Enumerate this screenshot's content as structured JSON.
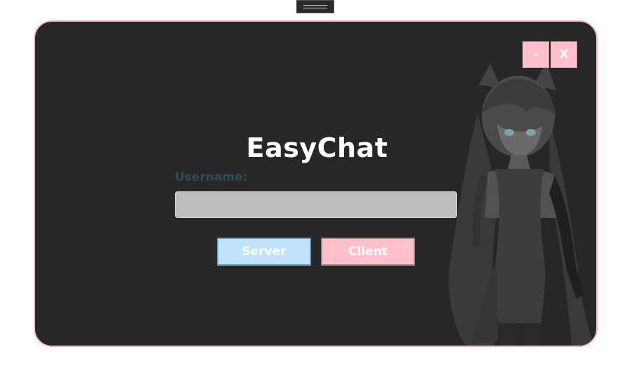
{
  "app": {
    "title": "EasyChat"
  },
  "window_controls": {
    "minimize_label": "-",
    "close_label": "X"
  },
  "form": {
    "username_label": "Username:",
    "username_value": "",
    "username_placeholder": ""
  },
  "actions": {
    "server_label": "Server",
    "client_label": "Client"
  },
  "colors": {
    "window_background": "#272727",
    "window_border": "#f4b6c2",
    "accent_pink": "#ffc0cb",
    "accent_blue": "#bfe3f8",
    "username_label": "#2f4f4f",
    "input_background": "#bdbdbd"
  },
  "icons": {
    "drag_handle": "drag-handle-icon",
    "character_art": "character-illustration"
  }
}
